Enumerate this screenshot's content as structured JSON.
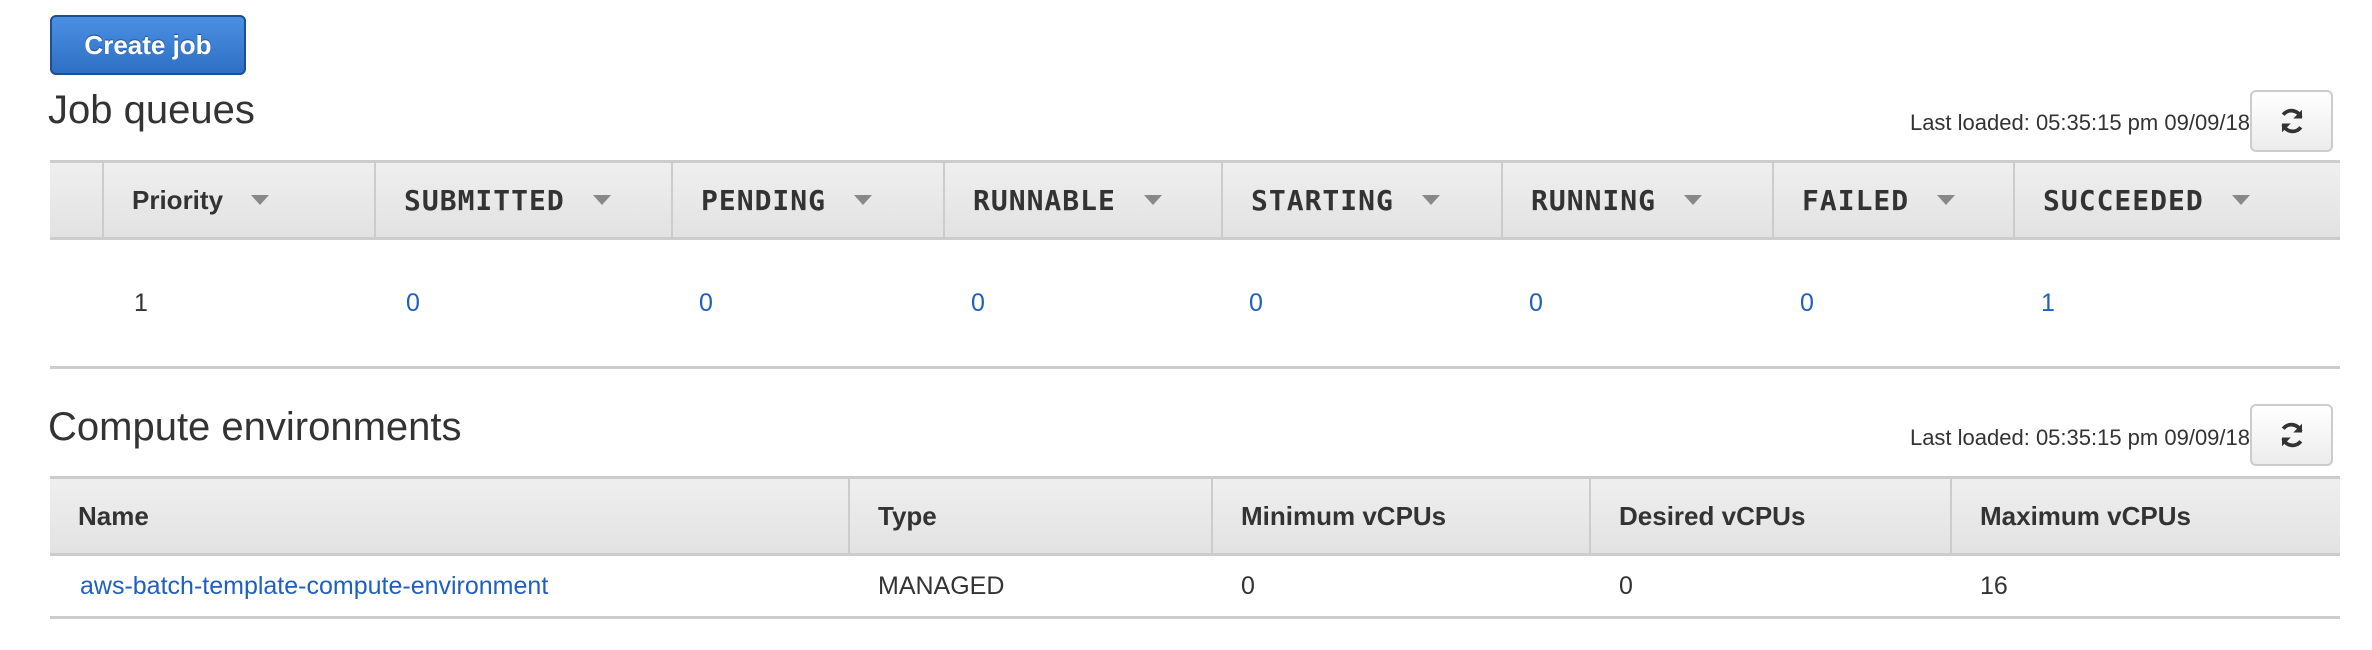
{
  "create_job_label": "Create job",
  "job_queues": {
    "title": "Job queues",
    "last_loaded": "Last loaded: 05:35:15 pm 09/09/18",
    "columns": [
      "Priority",
      "SUBMITTED",
      "PENDING",
      "RUNNABLE",
      "STARTING",
      "RUNNING",
      "FAILED",
      "SUCCEEDED"
    ],
    "row": [
      "1",
      "0",
      "0",
      "0",
      "0",
      "0",
      "0",
      "1"
    ]
  },
  "compute_environments": {
    "title": "Compute environments",
    "last_loaded": "Last loaded: 05:35:15 pm 09/09/18",
    "columns": [
      "Name",
      "Type",
      "Minimum vCPUs",
      "Desired vCPUs",
      "Maximum vCPUs"
    ],
    "row": [
      "aws-batch-template-compute-environment",
      "MANAGED",
      "0",
      "0",
      "16"
    ]
  }
}
